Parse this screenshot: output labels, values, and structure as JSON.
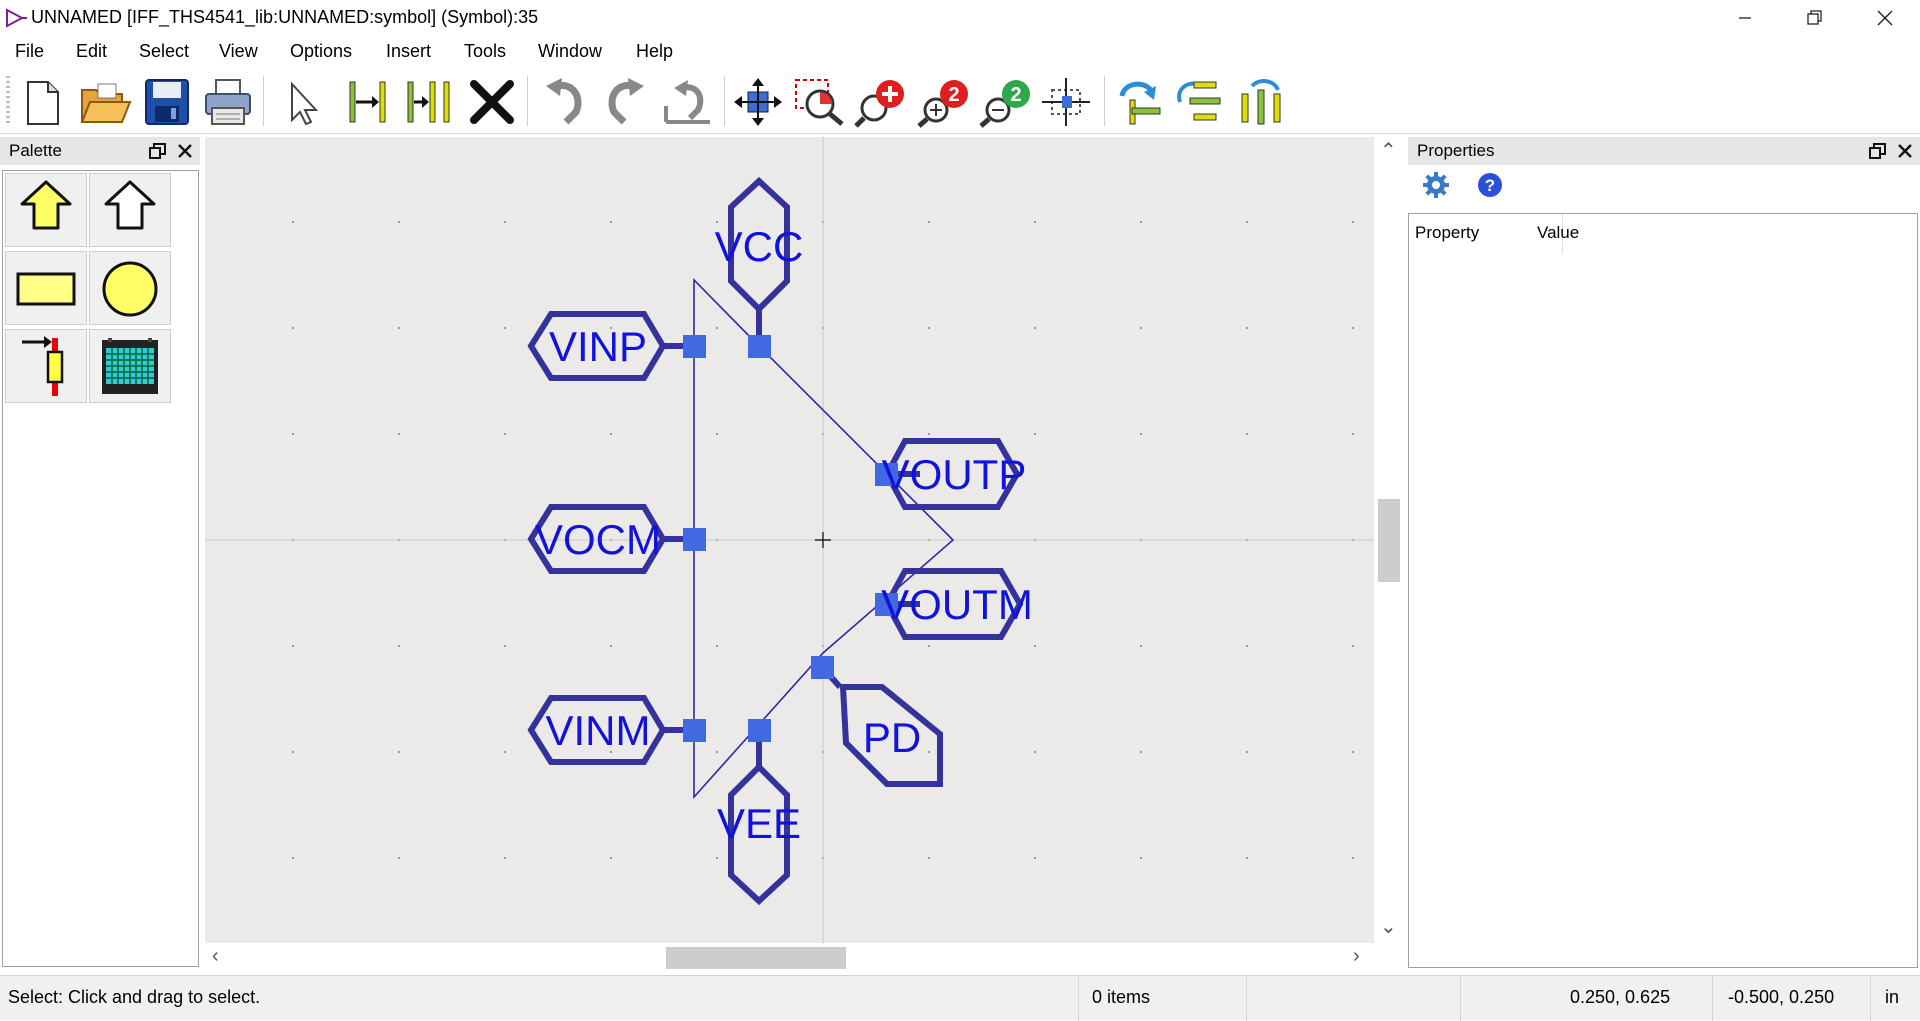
{
  "window": {
    "title": "UNNAMED [IFF_THS4541_lib:UNNAMED:symbol] (Symbol):35"
  },
  "menu": [
    "File",
    "Edit",
    "Select",
    "View",
    "Options",
    "Insert",
    "Tools",
    "Window",
    "Help"
  ],
  "toolbar": {
    "buttons": [
      "new-document-icon",
      "open-folder-icon",
      "save-disk-icon",
      "print-icon",
      "select-arrow-icon",
      "add-pin-icon",
      "add-pins-icon",
      "delete-x-icon",
      "undo-icon",
      "redo-icon",
      "undo-all-icon",
      "pan-icon",
      "zoom-fit-icon",
      "zoom-in-icon",
      "zoom-in-2x-icon",
      "zoom-out-2x-icon",
      "zoom-center-icon",
      "rotate-icon",
      "flip-vertical-icon",
      "flip-horizontal-icon"
    ]
  },
  "palette": {
    "title": "Palette",
    "items": [
      "input-arrow-shape-icon",
      "output-arrow-shape-icon",
      "rectangle-shape-icon",
      "circle-shape-icon",
      "pin-tool-icon",
      "graphic-block-icon"
    ]
  },
  "symbol": {
    "pins": [
      "VCC",
      "VINP",
      "VOUTP",
      "VOCM",
      "VOUTM",
      "VINM",
      "PD",
      "VEE"
    ],
    "colors": {
      "pin_outline": "#33339b",
      "pin_text": "#1212dd",
      "pin_square": "#4169e1",
      "body_line": "#2a2aa8",
      "canvas_bg": "#ece9e9"
    }
  },
  "properties": {
    "title": "Properties",
    "columns": [
      "Property",
      "Value"
    ]
  },
  "status": {
    "message": "Select: Click and drag to select.",
    "items": "0 items",
    "coord1": "0.250, 0.625",
    "coord2": "-0.500, 0.250",
    "units": "in"
  }
}
